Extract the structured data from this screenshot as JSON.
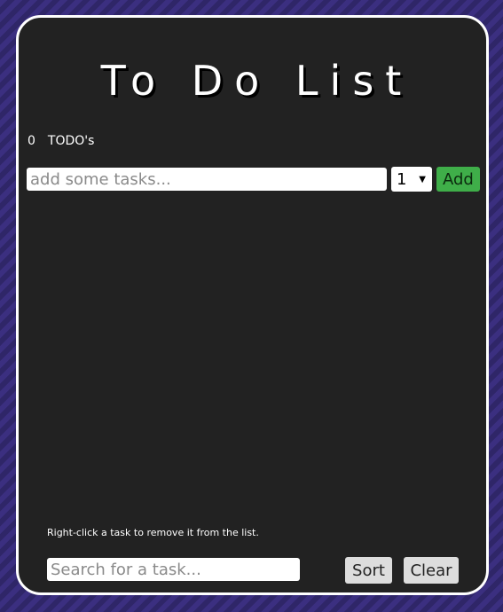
{
  "app": {
    "title": "To Do List"
  },
  "summary": {
    "count": "0",
    "label": "TODO's"
  },
  "add_form": {
    "task_placeholder": "add some tasks...",
    "task_value": "",
    "priority_selected": "1",
    "add_label": "Add"
  },
  "tasks": [],
  "footer": {
    "hint": "Right-click a task to remove it from the list.",
    "search_placeholder": "Search for a task...",
    "sort_label": "Sort",
    "clear_label": "Clear"
  },
  "colors": {
    "background_stripe_a": "#3b2f80",
    "background_stripe_b": "#2f2668",
    "card": "#222222",
    "card_border": "#ffffff",
    "add_button": "#3fae49",
    "gray_button": "#dddddd"
  }
}
